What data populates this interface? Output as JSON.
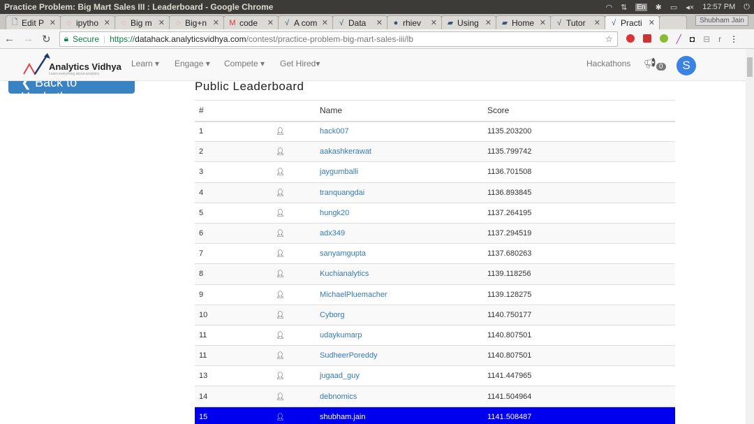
{
  "window": {
    "title": "Practice Problem: Big Mart Sales III : Leaderboard - Google Chrome",
    "time": "12:57 PM",
    "lang": "En",
    "user": "Shubham Jain"
  },
  "tabs": [
    {
      "label": "Edit P",
      "icon": "doc-icon"
    },
    {
      "label": "ipytho",
      "icon": "jupyter-icon"
    },
    {
      "label": "Big m",
      "icon": "jupyter-icon"
    },
    {
      "label": "Big+n",
      "icon": "jupyter-icon"
    },
    {
      "label": "code",
      "icon": "gmail-icon"
    },
    {
      "label": "A com",
      "icon": "av-icon"
    },
    {
      "label": "Data",
      "icon": "av-icon"
    },
    {
      "label": "rhiev",
      "icon": "github-icon"
    },
    {
      "label": "Using",
      "icon": "book-icon"
    },
    {
      "label": "Home",
      "icon": "book-icon"
    },
    {
      "label": "Tutor",
      "icon": "av-icon"
    },
    {
      "label": "Practi",
      "icon": "av-icon",
      "active": true
    }
  ],
  "address": {
    "secure": "Secure",
    "scheme": "https://",
    "host": "datahack.analyticsvidhya.com",
    "path": "/contest/practice-problem-big-mart-sales-iii/lb"
  },
  "site": {
    "logo": "Analytics Vidhya",
    "tagline": "Learn everything about analytics",
    "menu": [
      "Learn ▾",
      "Engage ▾",
      "Compete ▾",
      "Get Hired▾"
    ],
    "hackathons": "Hackathons",
    "notifications": "0",
    "avatar": "S",
    "back": "❮ Back to Hackathon"
  },
  "leaderboard": {
    "title": "Public Leaderboard",
    "columns": [
      "#",
      "",
      "Name",
      "Score"
    ],
    "rows": [
      {
        "rank": "1",
        "name": "hack007",
        "score": "1135.203200"
      },
      {
        "rank": "2",
        "name": "aakashkerawat",
        "score": "1135.799742"
      },
      {
        "rank": "3",
        "name": "jaygumballi",
        "score": "1136.701508"
      },
      {
        "rank": "4",
        "name": "tranquangdai",
        "score": "1136.893845"
      },
      {
        "rank": "5",
        "name": "hungk20",
        "score": "1137.264195"
      },
      {
        "rank": "6",
        "name": "adx349",
        "score": "1137.294519"
      },
      {
        "rank": "7",
        "name": "sanyamgupta",
        "score": "1137.680263"
      },
      {
        "rank": "8",
        "name": "Kuchianalytics",
        "score": "1139.118256"
      },
      {
        "rank": "9",
        "name": "MichaelPluemacher",
        "score": "1139.128275"
      },
      {
        "rank": "10",
        "name": "Cyborg",
        "score": "1140.750177"
      },
      {
        "rank": "11",
        "name": "udaykumarp",
        "score": "1140.807501"
      },
      {
        "rank": "11",
        "name": "SudheerPoreddy",
        "score": "1140.807501"
      },
      {
        "rank": "13",
        "name": "jugaad_guy",
        "score": "1141.447965"
      },
      {
        "rank": "14",
        "name": "debnomics",
        "score": "1141.504964"
      },
      {
        "rank": "15",
        "name": "shubham.jain",
        "score": "1141.508487",
        "highlighted": true
      }
    ]
  },
  "colors": {
    "highlight": "#0000ee",
    "link": "#337ab7",
    "button": "#3a83c3"
  }
}
